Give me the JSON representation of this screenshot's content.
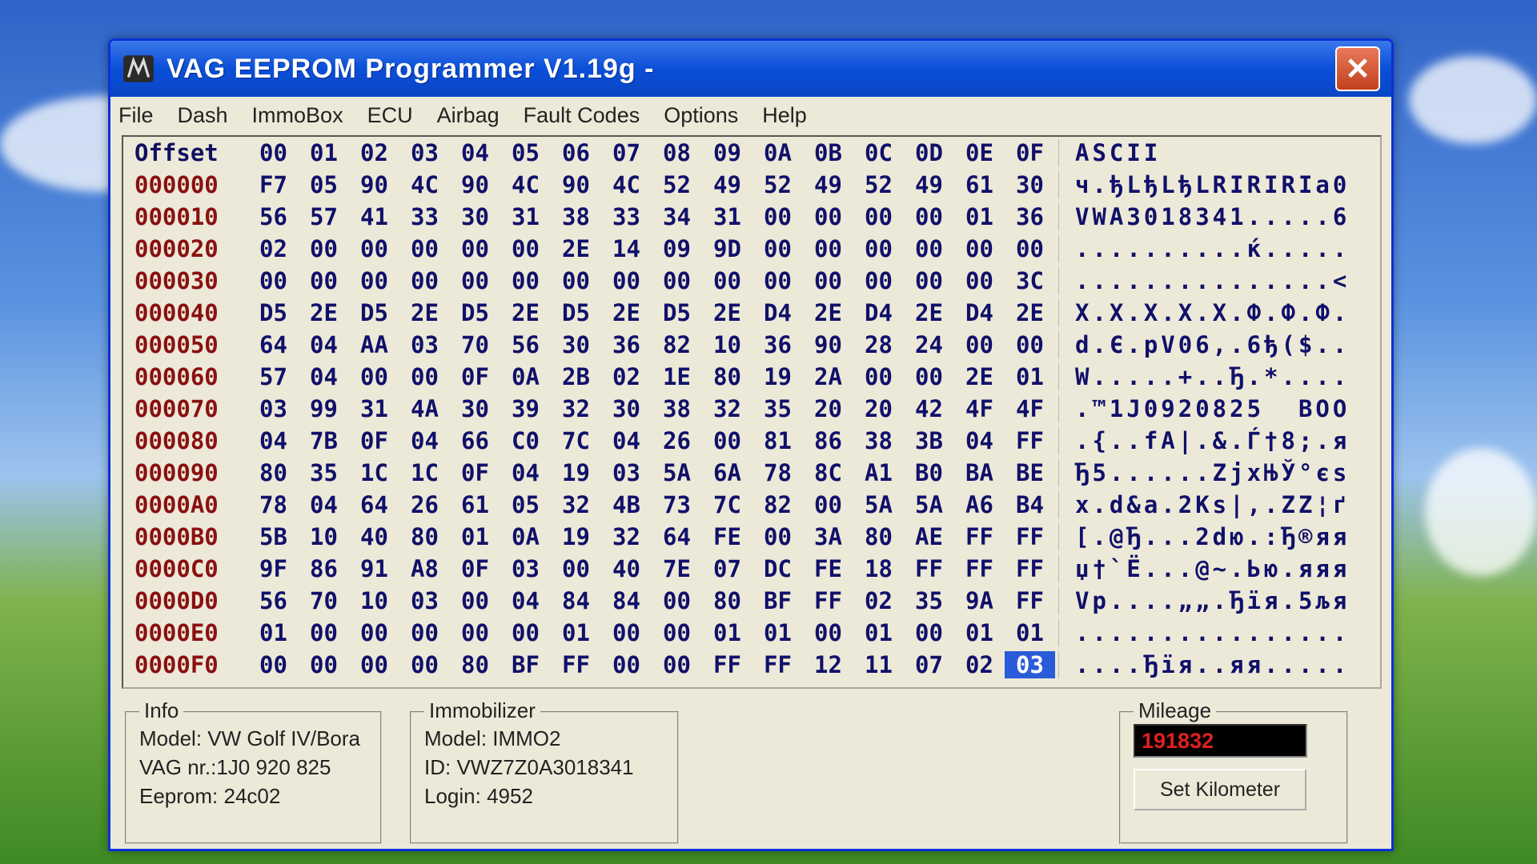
{
  "window": {
    "title": "VAG EEPROM Programmer  V1.19g -",
    "close_label": "✕"
  },
  "menu": [
    "File",
    "Dash",
    "ImmoBox",
    "ECU",
    "Airbag",
    "Fault Codes",
    "Options",
    "Help"
  ],
  "hex": {
    "header": {
      "offset": "Offset",
      "cols": [
        "00",
        "01",
        "02",
        "03",
        "04",
        "05",
        "06",
        "07",
        "08",
        "09",
        "0A",
        "0B",
        "0C",
        "0D",
        "0E",
        "0F"
      ],
      "ascii": "ASCII"
    },
    "rows": [
      {
        "offset": "000000",
        "bytes": [
          "F7",
          "05",
          "90",
          "4C",
          "90",
          "4C",
          "90",
          "4C",
          "52",
          "49",
          "52",
          "49",
          "52",
          "49",
          "61",
          "30"
        ],
        "ascii": "ч.ђLђLђLRIRIRIa0"
      },
      {
        "offset": "000010",
        "bytes": [
          "56",
          "57",
          "41",
          "33",
          "30",
          "31",
          "38",
          "33",
          "34",
          "31",
          "00",
          "00",
          "00",
          "00",
          "01",
          "36"
        ],
        "ascii": "VWA3018341.....6"
      },
      {
        "offset": "000020",
        "bytes": [
          "02",
          "00",
          "00",
          "00",
          "00",
          "00",
          "2E",
          "14",
          "09",
          "9D",
          "00",
          "00",
          "00",
          "00",
          "00",
          "00"
        ],
        "ascii": "..........ќ....."
      },
      {
        "offset": "000030",
        "bytes": [
          "00",
          "00",
          "00",
          "00",
          "00",
          "00",
          "00",
          "00",
          "00",
          "00",
          "00",
          "00",
          "00",
          "00",
          "00",
          "3C"
        ],
        "ascii": "...............<"
      },
      {
        "offset": "000040",
        "bytes": [
          "D5",
          "2E",
          "D5",
          "2E",
          "D5",
          "2E",
          "D5",
          "2E",
          "D5",
          "2E",
          "D4",
          "2E",
          "D4",
          "2E",
          "D4",
          "2E"
        ],
        "ascii": "Х.Х.Х.Х.Х.Ф.Ф.Ф."
      },
      {
        "offset": "000050",
        "bytes": [
          "64",
          "04",
          "AA",
          "03",
          "70",
          "56",
          "30",
          "36",
          "82",
          "10",
          "36",
          "90",
          "28",
          "24",
          "00",
          "00"
        ],
        "ascii": "d.Є.pV06,.6ђ($.."
      },
      {
        "offset": "000060",
        "bytes": [
          "57",
          "04",
          "00",
          "00",
          "0F",
          "0A",
          "2B",
          "02",
          "1E",
          "80",
          "19",
          "2A",
          "00",
          "00",
          "2E",
          "01"
        ],
        "ascii": "W.....+..Ђ.*...."
      },
      {
        "offset": "000070",
        "bytes": [
          "03",
          "99",
          "31",
          "4A",
          "30",
          "39",
          "32",
          "30",
          "38",
          "32",
          "35",
          "20",
          "20",
          "42",
          "4F",
          "4F"
        ],
        "ascii": ".™1J0920825  BOO"
      },
      {
        "offset": "000080",
        "bytes": [
          "04",
          "7B",
          "0F",
          "04",
          "66",
          "C0",
          "7C",
          "04",
          "26",
          "00",
          "81",
          "86",
          "38",
          "3B",
          "04",
          "FF"
        ],
        "ascii": ".{..fА|.&.Ѓ†8;.я"
      },
      {
        "offset": "000090",
        "bytes": [
          "80",
          "35",
          "1C",
          "1C",
          "0F",
          "04",
          "19",
          "03",
          "5A",
          "6A",
          "78",
          "8C",
          "A1",
          "B0",
          "BA",
          "BE"
        ],
        "ascii": "Ђ5......ZjxЊЎ°єѕ"
      },
      {
        "offset": "0000A0",
        "bytes": [
          "78",
          "04",
          "64",
          "26",
          "61",
          "05",
          "32",
          "4B",
          "73",
          "7C",
          "82",
          "00",
          "5A",
          "5A",
          "A6",
          "B4"
        ],
        "ascii": "x.d&a.2Ks|,.ZZ¦ґ"
      },
      {
        "offset": "0000B0",
        "bytes": [
          "5B",
          "10",
          "40",
          "80",
          "01",
          "0A",
          "19",
          "32",
          "64",
          "FE",
          "00",
          "3A",
          "80",
          "AE",
          "FF",
          "FF"
        ],
        "ascii": "[.@Ђ...2dю.:Ђ®яя"
      },
      {
        "offset": "0000C0",
        "bytes": [
          "9F",
          "86",
          "91",
          "A8",
          "0F",
          "03",
          "00",
          "40",
          "7E",
          "07",
          "DC",
          "FE",
          "18",
          "FF",
          "FF",
          "FF"
        ],
        "ascii": "џ†`Ё...@~.Ью.яяя"
      },
      {
        "offset": "0000D0",
        "bytes": [
          "56",
          "70",
          "10",
          "03",
          "00",
          "04",
          "84",
          "84",
          "00",
          "80",
          "BF",
          "FF",
          "02",
          "35",
          "9A",
          "FF"
        ],
        "ascii": "Vp....„„.Ђїя.5љя"
      },
      {
        "offset": "0000E0",
        "bytes": [
          "01",
          "00",
          "00",
          "00",
          "00",
          "00",
          "01",
          "00",
          "00",
          "01",
          "01",
          "00",
          "01",
          "00",
          "01",
          "01"
        ],
        "ascii": "................"
      },
      {
        "offset": "0000F0",
        "bytes": [
          "00",
          "00",
          "00",
          "00",
          "80",
          "BF",
          "FF",
          "00",
          "00",
          "FF",
          "FF",
          "12",
          "11",
          "07",
          "02",
          "03"
        ],
        "ascii": "....Ђїя..яя....."
      }
    ],
    "selected": {
      "row": 15,
      "col": 15
    }
  },
  "info": {
    "legend": "Info",
    "model": "Model:  VW Golf IV/Bora",
    "vag_nr": "VAG nr.:1J0 920 825",
    "eeprom": "Eeprom: 24c02"
  },
  "immobilizer": {
    "legend": "Immobilizer",
    "model": "Model:  IMMO2",
    "id": "ID: VWZ7Z0A3018341",
    "login": "Login: 4952"
  },
  "mileage": {
    "legend": "Mileage",
    "value": "191832",
    "button": "Set Kilometer"
  }
}
